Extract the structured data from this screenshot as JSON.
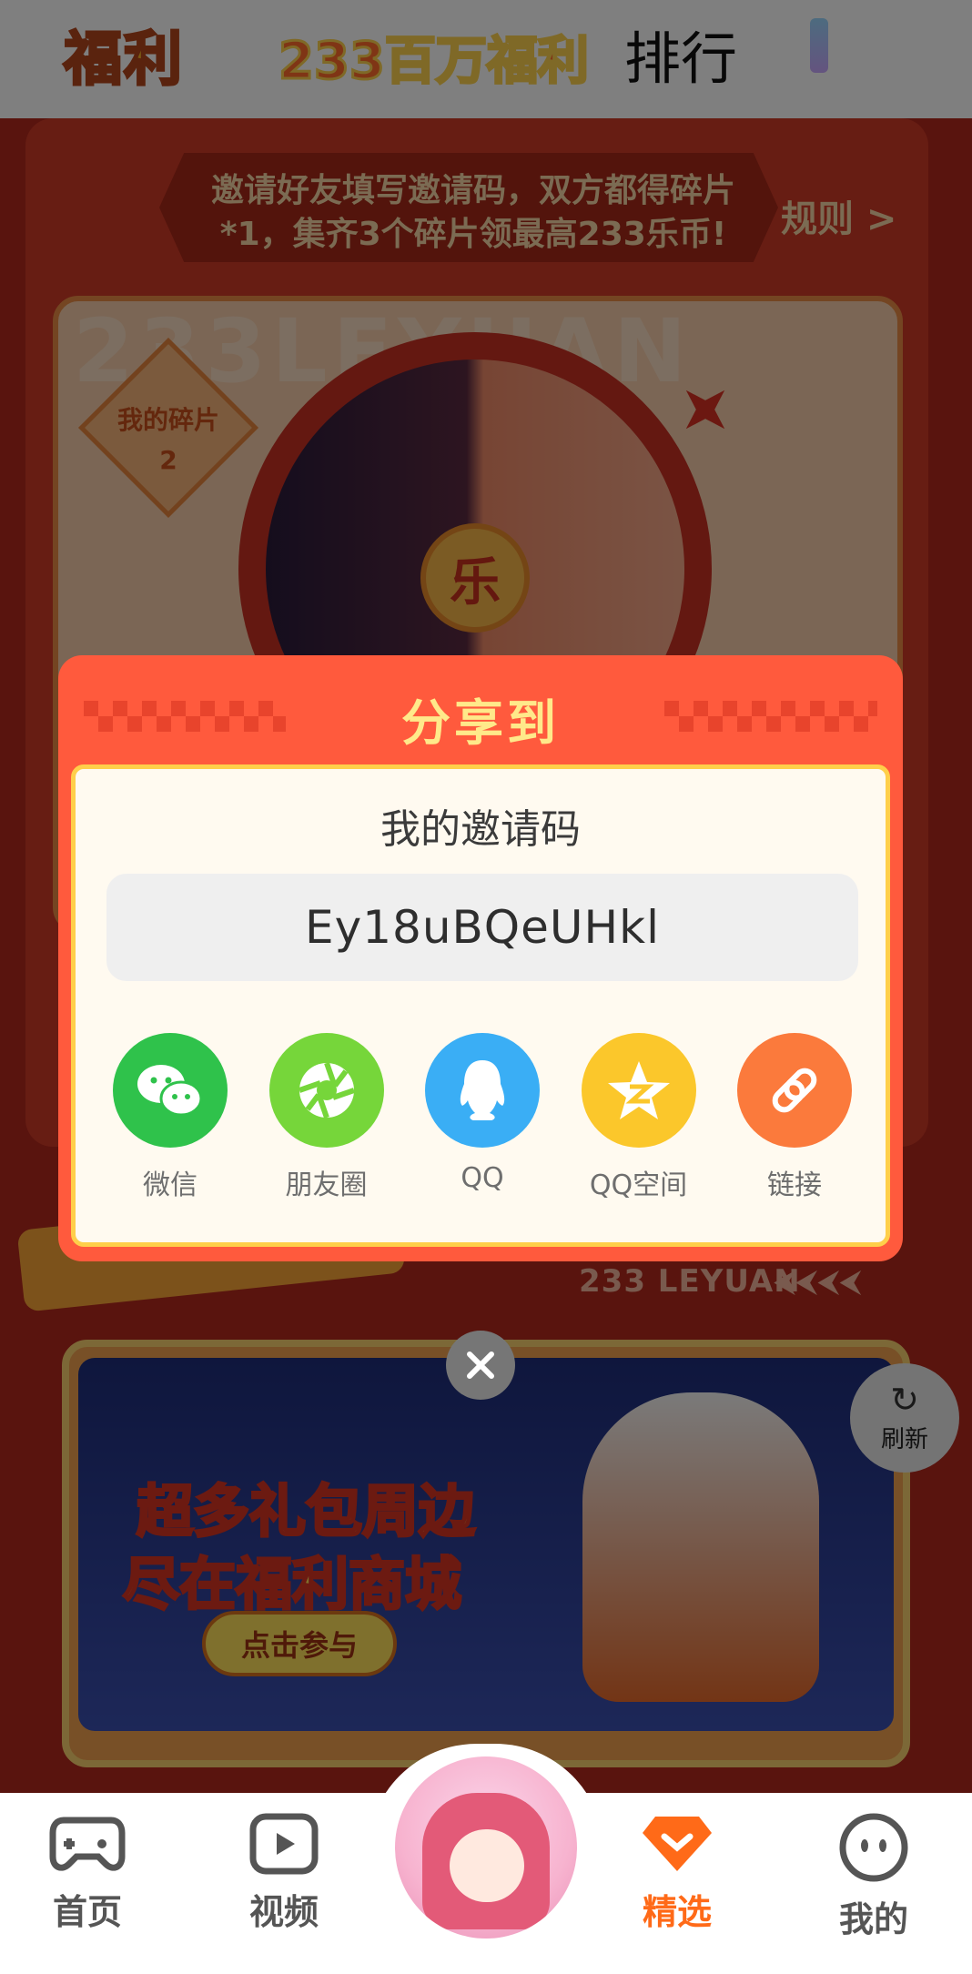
{
  "top_tabs": {
    "fuli": "福利",
    "baiwan": "233百万福利",
    "paihang": "排行"
  },
  "background": {
    "banner_text": "邀请好友填写邀请码，双方都得碎片*1，集齐3个碎片领最高233乐币!",
    "rules_link": "规则 >",
    "bg_word": "233LEYUAN",
    "my_fragments_label": "我的碎片",
    "my_fragments_count": "2",
    "wheel_center": "乐",
    "section_brand": "233 LEYUAN",
    "promo_line_1": "超多礼包周边",
    "promo_line_2": "尽在福利商城",
    "promo_button": "点击参与",
    "refresh_label": "刷新"
  },
  "dialog": {
    "title": "分享到",
    "code_heading": "我的邀请码",
    "invite_code": "Ey18uBQeUHkl",
    "share_options": [
      {
        "label": "微信",
        "icon": "wechat-icon",
        "color": "#2fc24b"
      },
      {
        "label": "朋友圈",
        "icon": "moments-icon",
        "color": "#76d63a"
      },
      {
        "label": "QQ",
        "icon": "qq-icon",
        "color": "#3aaef5"
      },
      {
        "label": "QQ空间",
        "icon": "qzone-icon",
        "color": "#fbc72b"
      },
      {
        "label": "链接",
        "icon": "link-icon",
        "color": "#fb7a3c"
      }
    ]
  },
  "bottom_nav": {
    "items": [
      {
        "label": "首页",
        "icon": "gamepad-icon",
        "active": false
      },
      {
        "label": "视频",
        "icon": "video-icon",
        "active": false
      },
      {
        "label": "精选",
        "icon": "featured-icon",
        "active": true
      },
      {
        "label": "我的",
        "icon": "profile-face-icon",
        "active": false
      }
    ]
  },
  "colors": {
    "accent": "#ff6a18",
    "dialog_red": "#ff5a3d",
    "dialog_title": "#ffe98a"
  }
}
